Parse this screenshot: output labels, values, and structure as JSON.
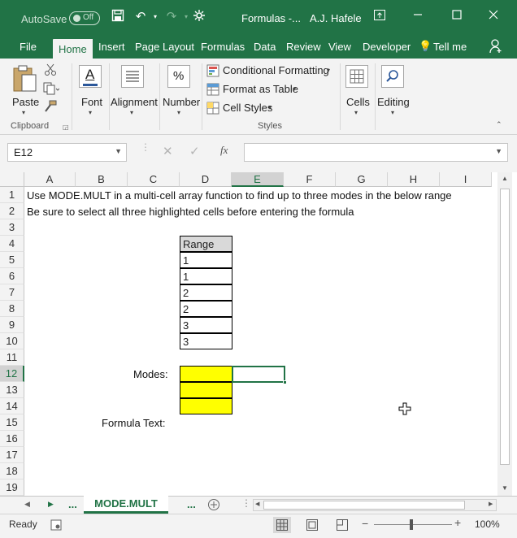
{
  "titlebar": {
    "autosave_label": "AutoSave",
    "autosave_state": "Off",
    "document_title": "Formulas -...",
    "user_name": "A.J. Hafele",
    "icons": [
      "save-icon",
      "undo-icon",
      "redo-icon",
      "customize-qat-icon",
      "ribbon-display-icon",
      "minimize-icon",
      "maximize-icon",
      "close-icon"
    ],
    "accent_color": "#217346"
  },
  "tabs": [
    "File",
    "Home",
    "Insert",
    "Page Layout",
    "Formulas",
    "Data",
    "Review",
    "View",
    "Developer",
    "Tell me"
  ],
  "active_tab": "Home",
  "ribbon": {
    "clipboard": {
      "paste": "Paste",
      "group": "Clipboard"
    },
    "font": "Font",
    "alignment": "Alignment",
    "number": "Number",
    "styles": {
      "conditional": "Conditional Formatting",
      "format_table": "Format as Table",
      "cell_styles": "Cell Styles",
      "group": "Styles"
    },
    "cells": "Cells",
    "editing": "Editing"
  },
  "formula_bar": {
    "name_box": "E12",
    "formula": ""
  },
  "columns": [
    "A",
    "B",
    "C",
    "D",
    "E",
    "F",
    "G",
    "H",
    "I"
  ],
  "selected_column": "E",
  "rows": [
    "1",
    "2",
    "3",
    "4",
    "5",
    "6",
    "7",
    "8",
    "9",
    "10",
    "11",
    "12",
    "13",
    "14",
    "15",
    "16",
    "17",
    "18",
    "19"
  ],
  "selected_row": "12",
  "sheet": {
    "a1": "Use MODE.MULT in a multi-cell array function to find up to three modes in the below range",
    "a2": "Be sure to select all three highlighted cells before entering the formula",
    "range_header": "Range",
    "range_values": [
      "1",
      "1",
      "2",
      "2",
      "3",
      "3"
    ],
    "modes_label": "Modes:",
    "formula_text_label": "Formula Text:",
    "highlight_color": "#ffff00"
  },
  "sheet_tabs": {
    "active": "MODE.MULT",
    "ellipsis_left": "...",
    "ellipsis_right": "..."
  },
  "status": {
    "ready": "Ready",
    "zoom": "100%"
  }
}
